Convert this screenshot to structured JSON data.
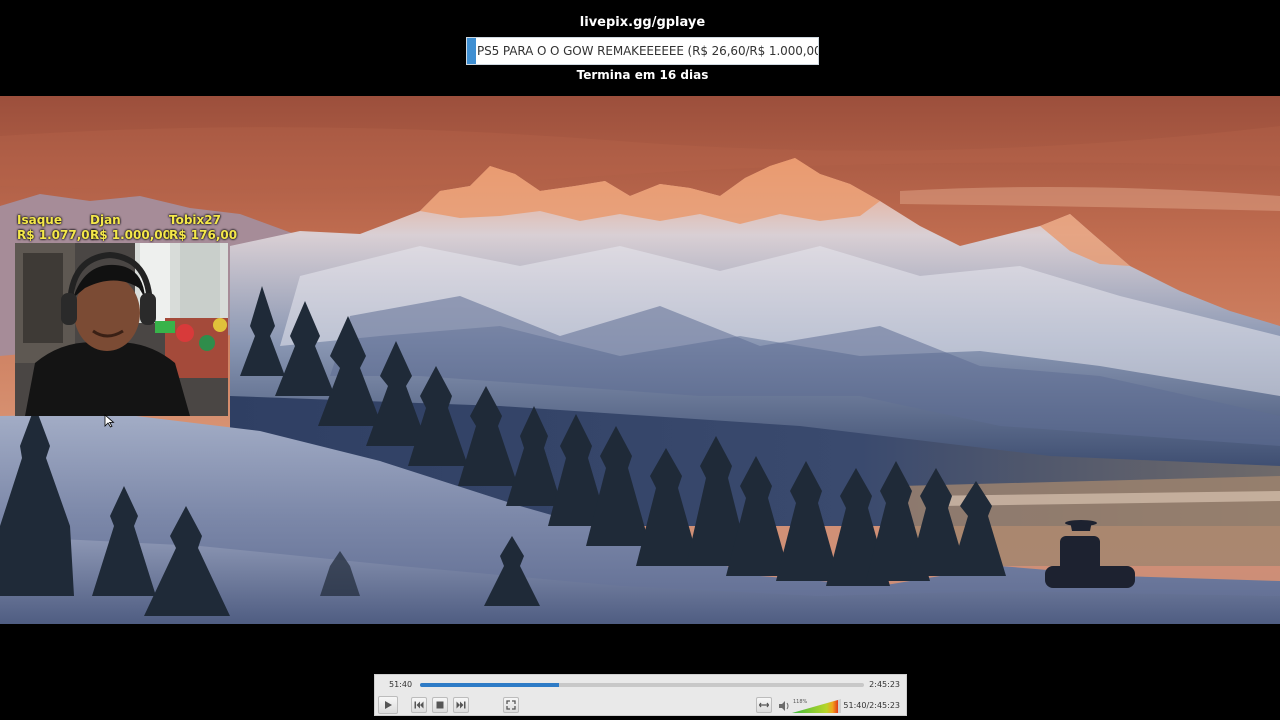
{
  "overlay": {
    "donation_url": "livepix.gg/gplaye",
    "goal_text": "PS5 PARA O O GOW REMAKEEEEEE (R$ 26,60/R$ 1.000,00)",
    "goal_progress_percent": 2.66,
    "goal_deadline": "Termina em 16 dias",
    "accent_color": "#3f8fd2"
  },
  "donors": [
    {
      "name": "Isaque",
      "amount": "R$ 1.077,01"
    },
    {
      "name": "Djan",
      "amount": "R$ 1.000,00"
    },
    {
      "name": "Tobix27",
      "amount": "R$ 176,00"
    }
  ],
  "donor_color": "#f5e84a",
  "player": {
    "time_elapsed": "51:40",
    "time_total": "2:45:23",
    "seek_progress_percent": 31.2,
    "position_readout": "51:40/2:45:23",
    "volume_percent": "118%",
    "seek_color": "#2e7bc6",
    "buttons": [
      "play-icon",
      "previous-icon",
      "stop-icon",
      "next-icon",
      "fullscreen-icon",
      "extended-settings-icon",
      "speaker-icon"
    ]
  }
}
